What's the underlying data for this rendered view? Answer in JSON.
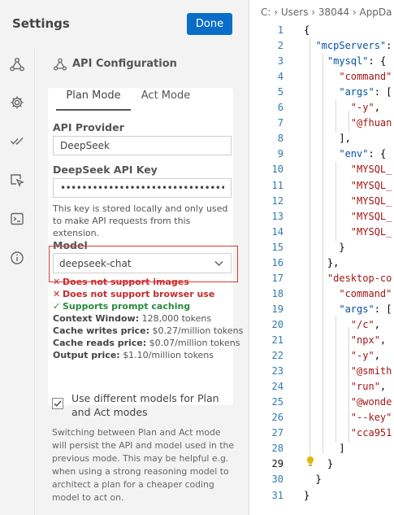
{
  "settings": {
    "title": "Settings",
    "done_label": "Done",
    "rail_icons": [
      "robot-icon",
      "gear-icon",
      "check-icon",
      "mcp-icon",
      "terminal-icon",
      "info-icon"
    ],
    "section_title": "API Configuration",
    "tabs": {
      "plan": "Plan Mode",
      "act": "Act Mode"
    },
    "api_provider_label": "API Provider",
    "api_provider_value": "DeepSeek",
    "api_key_label": "DeepSeek API Key",
    "api_key_value": "•••••••••••••••••••••••••••••••••••",
    "api_key_note": "This key is stored locally and only used to make API requests from this extension.",
    "model_label": "Model",
    "model_value": "deepseek-chat",
    "capabilities": [
      {
        "ok": false,
        "text": "Does not support images"
      },
      {
        "ok": false,
        "text": "Does not support browser use"
      },
      {
        "ok": true,
        "text": "Supports prompt caching"
      }
    ],
    "stats": [
      {
        "label": "Context Window:",
        "value": "128,000 tokens"
      },
      {
        "label": "Cache writes price:",
        "value": "$0.27/million tokens"
      },
      {
        "label": "Cache reads price:",
        "value": "$0.07/million tokens"
      },
      {
        "label": "Output price:",
        "value": "$1.10/million tokens"
      }
    ],
    "checkbox_checked": true,
    "checkbox_label": "Use different models for Plan and Act modes",
    "switch_note": "Switching between Plan and Act mode will persist the API and model used in the previous mode. This may be helpful e.g. when using a strong reasoning model to architect a plan for a cheaper coding model to act on.",
    "colors": {
      "accent": "#0a6ec9",
      "error": "#c42b2b",
      "success": "#2b8a3e",
      "highlight": "#d93a3a"
    }
  },
  "editor": {
    "breadcrumb": "C: › Users › 38044 › AppDa",
    "active_line": 29,
    "lines": [
      {
        "n": "1",
        "text": "{"
      },
      {
        "n": "2",
        "text": "  \"mcpServers\":"
      },
      {
        "n": "3",
        "text": "    \"mysql\": {"
      },
      {
        "n": "4",
        "text": "      \"command\""
      },
      {
        "n": "5",
        "text": "      \"args\": ["
      },
      {
        "n": "6",
        "text": "        \"-y\","
      },
      {
        "n": "7",
        "text": "        \"@fhuan"
      },
      {
        "n": "8",
        "text": "      ],"
      },
      {
        "n": "9",
        "text": "      \"env\": {"
      },
      {
        "n": "10",
        "text": "        \"MYSQL_"
      },
      {
        "n": "11",
        "text": "        \"MYSQL_"
      },
      {
        "n": "12",
        "text": "        \"MYSQL_"
      },
      {
        "n": "13",
        "text": "        \"MYSQL_"
      },
      {
        "n": "14",
        "text": "        \"MYSQL_"
      },
      {
        "n": "15",
        "text": "      }"
      },
      {
        "n": "16",
        "text": "    },"
      },
      {
        "n": "17",
        "text": "    \"desktop-co"
      },
      {
        "n": "18",
        "text": "      \"command\""
      },
      {
        "n": "19",
        "text": "      \"args\": ["
      },
      {
        "n": "20",
        "text": "        \"/c\","
      },
      {
        "n": "21",
        "text": "        \"npx\","
      },
      {
        "n": "22",
        "text": "        \"-y\","
      },
      {
        "n": "23",
        "text": "        \"@smith"
      },
      {
        "n": "24",
        "text": "        \"run\","
      },
      {
        "n": "25",
        "text": "        \"@wonde"
      },
      {
        "n": "26",
        "text": "        \"--key\""
      },
      {
        "n": "27",
        "text": "        \"cca951"
      },
      {
        "n": "28",
        "text": "      ]"
      },
      {
        "n": "29",
        "text": "    }"
      },
      {
        "n": "30",
        "text": "  }"
      },
      {
        "n": "31",
        "text": "}"
      }
    ]
  }
}
